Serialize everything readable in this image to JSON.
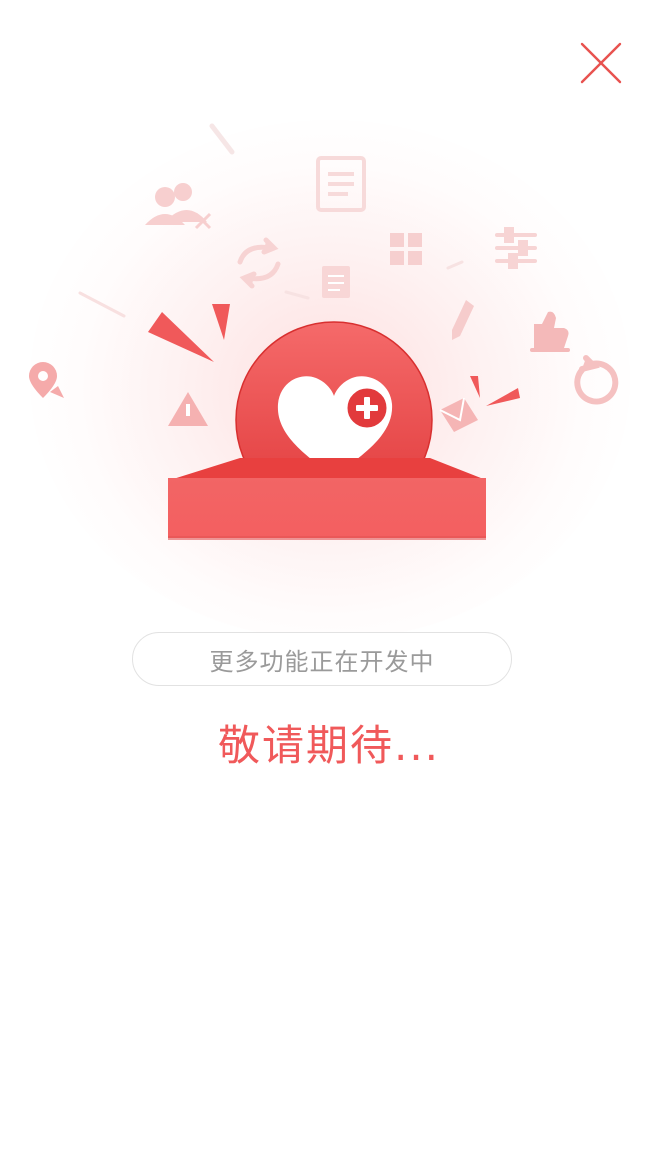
{
  "close": {
    "icon": "close-icon"
  },
  "illustration": {
    "main_icon": "heart-plus-icon",
    "background_icons": [
      "users-icon",
      "clipboard-icon",
      "refresh-arrows-icon",
      "grid-icon",
      "sliders-icon",
      "document-icon",
      "pencil-icon",
      "thumbs-up-icon",
      "location-pin-icon",
      "warning-icon",
      "envelope-icon",
      "rotate-icon"
    ]
  },
  "status_text": "更多功能正在开发中",
  "stay_tuned_text": "敬请期待...",
  "colors": {
    "accent": "#f0595a",
    "accent_dark": "#e23a3c",
    "faint_icon": "#f9d6d6",
    "muted_text": "#9a9a9a"
  }
}
